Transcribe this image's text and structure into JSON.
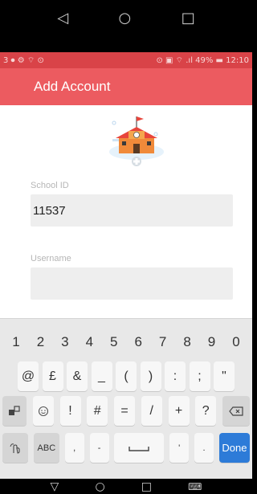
{
  "system_nav_top": {
    "back": "◁",
    "home": "○",
    "recents": "□"
  },
  "status_bar": {
    "left_icons": "3 ⏺ ⚙ ⌔ ⊙",
    "right": "⊙ ▣ ⌔ .ıl 49% ▬ 12:10"
  },
  "app_bar": {
    "title": "Add Account"
  },
  "form": {
    "school_id_label": "School ID",
    "school_id_value": "11537",
    "username_label": "Username",
    "username_value": ""
  },
  "keyboard": {
    "row_numbers": [
      "1",
      "2",
      "3",
      "4",
      "5",
      "6",
      "7",
      "8",
      "9",
      "0"
    ],
    "row_symbols1": [
      "@",
      "£",
      "&",
      "_",
      "(",
      ")",
      ":",
      ";",
      "\""
    ],
    "row_symbols2": [
      "!",
      "#",
      "=",
      "/",
      "+",
      "?"
    ],
    "row_bottom": {
      "abc_label": "ABC",
      "comma": ",",
      "dash": "-",
      "apostrophe": "'",
      "period": ".",
      "done_label": "Done"
    }
  },
  "system_nav_bottom": {
    "back": "▽",
    "home": "○",
    "recents": "□",
    "keyboard": "⌨"
  }
}
